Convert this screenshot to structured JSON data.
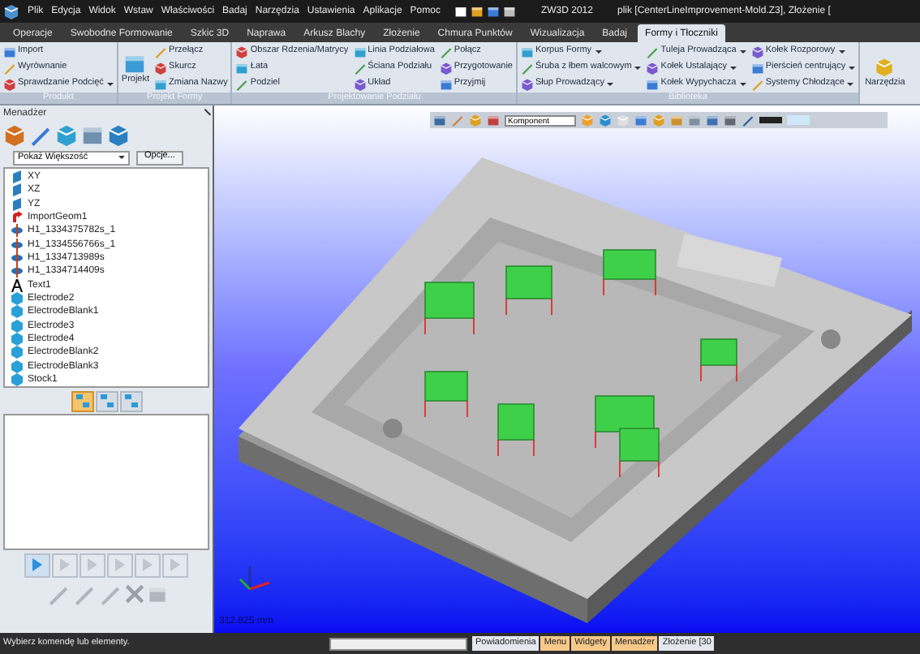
{
  "menu_bar": {
    "items": [
      "Plik",
      "Edycja",
      "Widok",
      "Wstaw",
      "Właściwości",
      "Badaj",
      "Narzędzia",
      "Ustawienia",
      "Aplikacje",
      "Pomoc"
    ],
    "app_title": "ZW3D 2012",
    "document_title": "plik [CenterLineImprovement-Mold.Z3], Złożenie ["
  },
  "tabs": [
    {
      "label": "Operacje",
      "selected": false
    },
    {
      "label": "Swobodne Formowanie",
      "selected": false
    },
    {
      "label": "Szkic 3D",
      "selected": false
    },
    {
      "label": "Naprawa",
      "selected": false
    },
    {
      "label": "Arkusz Blachy",
      "selected": false
    },
    {
      "label": "Złożenie",
      "selected": false
    },
    {
      "label": "Chmura Punktów",
      "selected": false
    },
    {
      "label": "Wizualizacja",
      "selected": false
    },
    {
      "label": "Badaj",
      "selected": false
    },
    {
      "label": "Formy i Tłoczniki",
      "selected": true
    }
  ],
  "ribbon": {
    "groups": [
      {
        "title": "Produkt",
        "columns": [
          [
            {
              "label": "Import",
              "dropdown": false
            },
            {
              "label": "Wyrównanie",
              "dropdown": false
            },
            {
              "label": "Sprawdzanie Podcięć",
              "dropdown": true
            }
          ]
        ]
      },
      {
        "title": "Projekt Formy",
        "large_button": "Projekt",
        "columns": [
          [
            {
              "label": "Przełącz",
              "dropdown": false
            },
            {
              "label": "Skurcz",
              "dropdown": false
            },
            {
              "label": "Zmiana Nazwy",
              "dropdown": false
            }
          ]
        ]
      },
      {
        "title": "Projektowanie Podziału",
        "columns": [
          [
            {
              "label": "Obszar Rdzenia/Matrycy",
              "dropdown": false
            },
            {
              "label": "Łata",
              "dropdown": false
            },
            {
              "label": "Podziel",
              "dropdown": false
            }
          ],
          [
            {
              "label": "Linia Podziałowa",
              "dropdown": false
            },
            {
              "label": "Ściana Podziału",
              "dropdown": false
            },
            {
              "label": "Układ",
              "dropdown": false
            }
          ],
          [
            {
              "label": "Połącz",
              "dropdown": false
            },
            {
              "label": "Przygotowanie",
              "dropdown": false
            },
            {
              "label": "Przyjmij",
              "dropdown": false
            }
          ]
        ]
      },
      {
        "title": "Biblioteka",
        "columns": [
          [
            {
              "label": "Korpus Formy",
              "dropdown": true
            },
            {
              "label": "Śruba z łbem walcowym",
              "dropdown": true
            },
            {
              "label": "Słup Prowadzący",
              "dropdown": true
            }
          ],
          [
            {
              "label": "Tuleja Prowadząca",
              "dropdown": true
            },
            {
              "label": "Kołek Ustalający",
              "dropdown": true
            },
            {
              "label": "Kołek Wypychacza",
              "dropdown": true
            }
          ],
          [
            {
              "label": "Kołek Rozporowy",
              "dropdown": true
            },
            {
              "label": "Pierścień centrujący",
              "dropdown": true
            },
            {
              "label": "Systemy Chłodzące",
              "dropdown": true
            }
          ]
        ]
      }
    ],
    "tools_button": "Narzędzia"
  },
  "manager": {
    "title": "Menadżer",
    "filter": "Pokaż Większość",
    "options_button": "Opcje...",
    "tree": [
      {
        "label": "XY",
        "kind": "plane"
      },
      {
        "label": "XZ",
        "kind": "plane"
      },
      {
        "label": "YZ",
        "kind": "plane"
      },
      {
        "label": "ImportGeom1",
        "kind": "import"
      },
      {
        "label": "H1_1334375782s_1",
        "kind": "hole"
      },
      {
        "label": "H1_1334556766s_1",
        "kind": "hole"
      },
      {
        "label": "H1_1334713989s",
        "kind": "hole"
      },
      {
        "label": "H1_1334714409s",
        "kind": "hole"
      },
      {
        "label": "Text1",
        "kind": "text"
      },
      {
        "label": "Electrode2",
        "kind": "solid"
      },
      {
        "label": "ElectrodeBlank1",
        "kind": "solid"
      },
      {
        "label": "Electrode3",
        "kind": "solid"
      },
      {
        "label": "Electrode4",
        "kind": "solid"
      },
      {
        "label": "ElectrodeBlank2",
        "kind": "solid"
      },
      {
        "label": "ElectrodeBlank3",
        "kind": "solid"
      },
      {
        "label": "Stock1",
        "kind": "solid"
      }
    ],
    "view_modes": [
      {
        "selected": true
      },
      {
        "selected": false
      },
      {
        "selected": false
      }
    ],
    "playback": [
      {
        "disabled": false
      },
      {
        "disabled": true
      },
      {
        "disabled": true
      },
      {
        "disabled": true
      },
      {
        "disabled": true
      },
      {
        "disabled": true
      }
    ]
  },
  "viewport": {
    "filter": "Komponent",
    "scale": "312.825 mm"
  },
  "status_bar": {
    "prompt": "Wybierz komendę lub elementy.",
    "panels": [
      {
        "label": "Powiadomienia",
        "highlighted": false
      },
      {
        "label": "Menu",
        "highlighted": true
      },
      {
        "label": "Widgety",
        "highlighted": true
      },
      {
        "label": "Menadżer",
        "highlighted": true
      },
      {
        "label": "Złożenie [30",
        "highlighted": false
      }
    ]
  }
}
